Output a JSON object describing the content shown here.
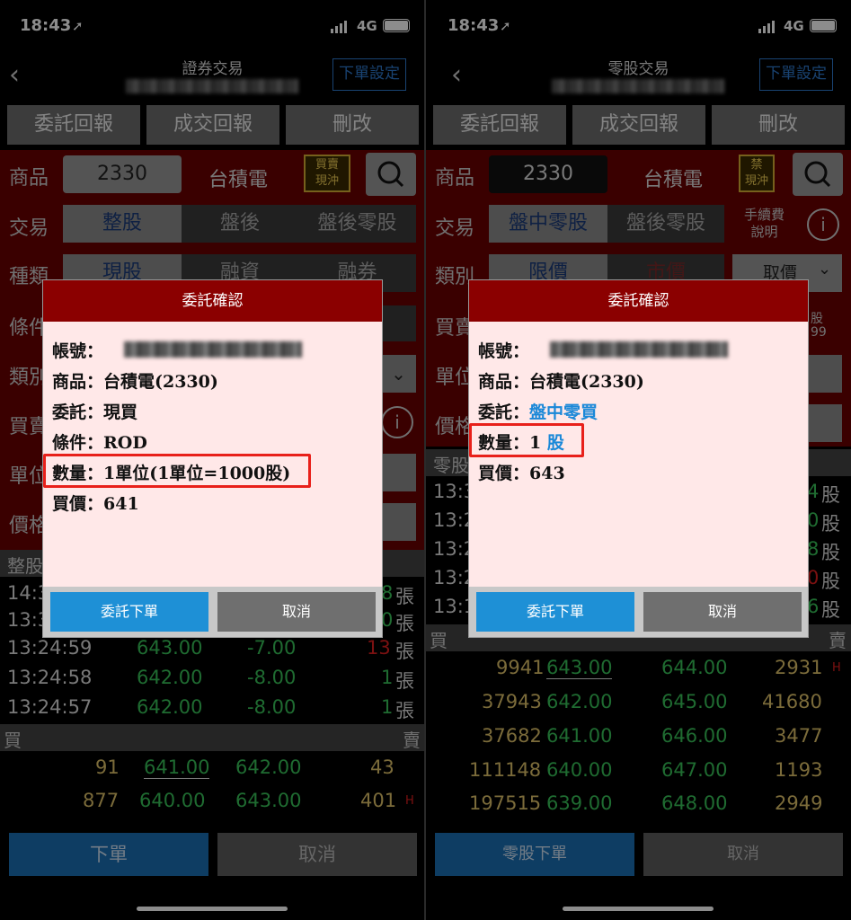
{
  "left": {
    "status": {
      "time": "18:43",
      "network": "4G"
    },
    "nav": {
      "title": "證券交易",
      "settings": "下單設定"
    },
    "tabs": [
      "委託回報",
      "成交回報",
      "刪改"
    ],
    "product": {
      "label": "商品",
      "code": "2330",
      "name": "台積電",
      "badge_line1": "買賣",
      "badge_line2": "現沖"
    },
    "trade": {
      "label": "交易",
      "options": [
        "整股",
        "盤後",
        "盤後零股"
      ]
    },
    "kind": {
      "label": "種類",
      "options": [
        "現股",
        "融資",
        "融券"
      ]
    },
    "partial_labels": [
      "條件",
      "類別",
      "買賣",
      "單位",
      "價格"
    ],
    "section_label": "整股",
    "trades": [
      {
        "time": "14:3",
        "unit_count": "8",
        "unit": "張"
      },
      {
        "time": "13:3",
        "unit_count": "0",
        "unit": "張"
      },
      {
        "time": "13:24:59",
        "price": "643.00",
        "change": "-7.00",
        "vol": "13",
        "unit": "張"
      },
      {
        "time": "13:24:58",
        "price": "642.00",
        "change": "-8.00",
        "vol": "1",
        "unit": "張"
      },
      {
        "time": "13:24:57",
        "price": "642.00",
        "change": "-8.00",
        "vol": "1",
        "unit": "張"
      }
    ],
    "book_buy": "買",
    "book_sell": "賣",
    "book": [
      {
        "bid_vol": "91",
        "bid": "641.00",
        "ask": "642.00",
        "ask_vol": "43",
        "flag": ""
      },
      {
        "bid_vol": "877",
        "bid": "640.00",
        "ask": "643.00",
        "ask_vol": "401",
        "flag": "H"
      }
    ],
    "footer": {
      "order": "下單",
      "cancel": "取消"
    },
    "dialog": {
      "title": "委託確認",
      "account": "帳號：",
      "product": "商品：台積電(2330)",
      "order": "委託：現買",
      "condition": "條件：ROD",
      "quantity": "數量：1單位(1單位=1000股)",
      "price": "買價：641",
      "confirm": "委託下單",
      "cancel": "取消"
    }
  },
  "right": {
    "status": {
      "time": "18:43",
      "network": "4G"
    },
    "nav": {
      "title": "零股交易",
      "settings": "下單設定"
    },
    "tabs": [
      "委託回報",
      "成交回報",
      "刪改"
    ],
    "product": {
      "label": "商品",
      "code": "2330",
      "name": "台積電",
      "badge_line1": "禁",
      "badge_line2": "現沖"
    },
    "trade": {
      "label": "交易",
      "options": [
        "盤中零股",
        "盤後零股"
      ],
      "fee_line1": "手續費",
      "fee_line2": "說明"
    },
    "kind": {
      "label": "類別",
      "options": [
        "限價",
        "市價"
      ],
      "price_select": "取價"
    },
    "partial_labels": [
      "買賣",
      "單位",
      "價格"
    ],
    "partial_right": [
      "股",
      "99"
    ],
    "section_label": "零股",
    "trades": [
      {
        "time": "13:3",
        "vol": "4",
        "unit": "股"
      },
      {
        "time": "13:2",
        "vol": "0",
        "unit": "股"
      },
      {
        "time": "13:2",
        "vol": "8",
        "unit": "股"
      },
      {
        "time": "13:2",
        "vol": "0",
        "unit": "股"
      },
      {
        "time": "13:1",
        "vol": "6",
        "unit": "股"
      }
    ],
    "book_buy": "買",
    "book_sell": "賣",
    "book": [
      {
        "bid_vol": "9941",
        "bid": "643.00",
        "ask": "644.00",
        "ask_vol": "2931",
        "flag": "H"
      },
      {
        "bid_vol": "37943",
        "bid": "642.00",
        "ask": "645.00",
        "ask_vol": "41680",
        "flag": ""
      },
      {
        "bid_vol": "37682",
        "bid": "641.00",
        "ask": "646.00",
        "ask_vol": "3477",
        "flag": ""
      },
      {
        "bid_vol": "111148",
        "bid": "640.00",
        "ask": "647.00",
        "ask_vol": "1193",
        "flag": ""
      },
      {
        "bid_vol": "197515",
        "bid": "639.00",
        "ask": "648.00",
        "ask_vol": "2949",
        "flag": ""
      }
    ],
    "footer": {
      "order": "零股下單",
      "cancel": "取消"
    },
    "dialog": {
      "title": "委託確認",
      "account": "帳號：",
      "product": "商品：台積電(2330)",
      "order_label": "委託：",
      "order_value": "盤中零買",
      "quantity_label": "數量：1 ",
      "quantity_unit": "股",
      "price": "買價：643",
      "confirm": "委託下單",
      "cancel": "取消"
    }
  },
  "colors": {
    "dialog_header": "#8b0000",
    "confirm_button": "#1e90d6",
    "highlight": "#e8201a",
    "up": "#e02020",
    "down": "#39c45a"
  }
}
